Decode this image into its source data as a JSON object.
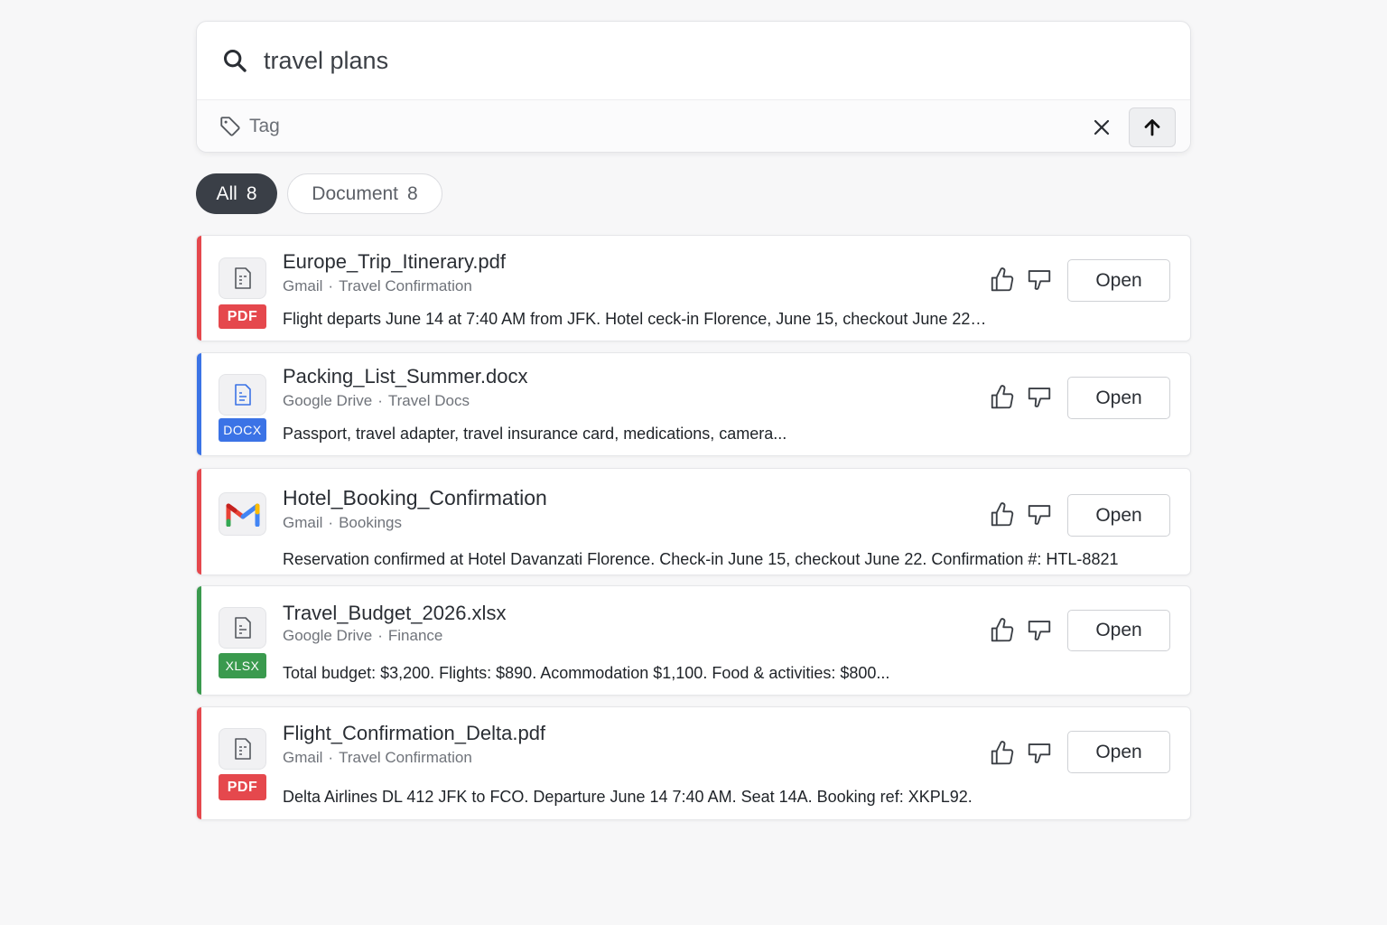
{
  "search": {
    "query": "travel plans",
    "tag_placeholder": "Tag"
  },
  "filters": [
    {
      "label": "All",
      "count": "8"
    },
    {
      "label": "Document",
      "count": "8"
    }
  ],
  "results": [
    {
      "title": "Europe_Trip_Itinerary.pdf",
      "source": "Gmail",
      "folder": "Travel Confirmation",
      "snippet": "Flight departs June 14 at 7:40 AM from JFK. Hotel ceck-in Florence, June 15, checkout June 22…",
      "badge": "PDF",
      "accent_color": "#e5484d",
      "icon": "document-icon",
      "open_label": "Open"
    },
    {
      "title": "Packing_List_Summer.docx",
      "source": "Google Drive",
      "folder": "Travel Docs",
      "snippet": "Passport, travel adapter, travel insurance card, medications, camera...",
      "badge": "DOCX",
      "accent_color": "#3b73e6",
      "icon": "document-icon",
      "open_label": "Open"
    },
    {
      "title": "Hotel_Booking_Confirmation",
      "source": "Gmail",
      "folder": "Bookings",
      "snippet": "Reservation confirmed at Hotel Davanzati Florence. Check-in June 15, checkout June 22. Confirmation #: HTL-8821",
      "badge": "",
      "accent_color": "#e5484d",
      "icon": "gmail-icon",
      "open_label": "Open"
    },
    {
      "title": "Travel_Budget_2026.xlsx",
      "source": "Google Drive",
      "folder": "Finance",
      "snippet": "Total budget: $3,200. Flights: $890. Acommodation $1,100. Food & activities: $800...",
      "badge": "XLSX",
      "accent_color": "#3a9a4e",
      "icon": "document-icon",
      "open_label": "Open"
    },
    {
      "title": "Flight_Confirmation_Delta.pdf",
      "source": "Gmail",
      "folder": "Travel Confirmation",
      "snippet": "Delta Airlines DL 412 JFK to FCO. Departure June 14 7:40 AM. Seat 14A. Booking ref: XKPL92.",
      "badge": "PDF",
      "accent_color": "#e5484d",
      "icon": "document-icon",
      "open_label": "Open"
    }
  ],
  "colors": {
    "pdf": "#e5484d",
    "docx": "#3b73e6",
    "xlsx": "#3a9a4e",
    "chip_active": "#3a3f47"
  }
}
